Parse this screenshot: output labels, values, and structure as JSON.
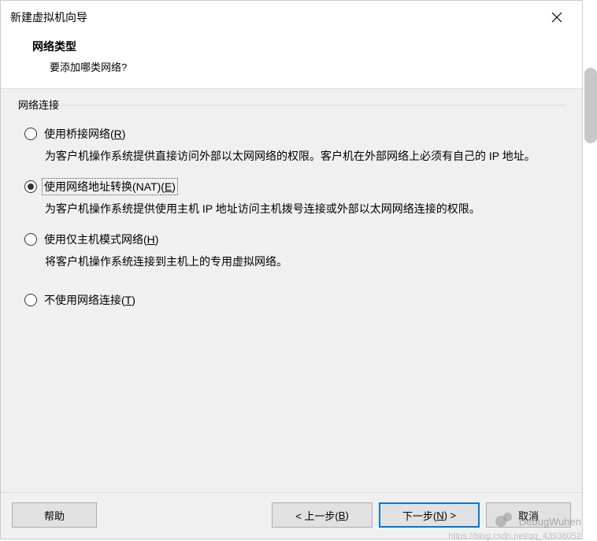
{
  "titlebar": {
    "title": "新建虚拟机向导"
  },
  "header": {
    "title": "网络类型",
    "subtitle": "要添加哪类网络?"
  },
  "group": {
    "label": "网络连接"
  },
  "options": {
    "bridged": {
      "label_pre": "使用桥接网络(",
      "mnemonic": "R",
      "label_post": ")",
      "desc": "为客户机操作系统提供直接访问外部以太网网络的权限。客户机在外部网络上必须有自己的 IP 地址。"
    },
    "nat": {
      "label_pre": "使用网络地址转换(NAT)(",
      "mnemonic": "E",
      "label_post": ")",
      "desc": "为客户机操作系统提供使用主机 IP 地址访问主机拨号连接或外部以太网网络连接的权限。"
    },
    "hostonly": {
      "label_pre": "使用仅主机模式网络(",
      "mnemonic": "H",
      "label_post": ")",
      "desc": "将客户机操作系统连接到主机上的专用虚拟网络。"
    },
    "none": {
      "label_pre": "不使用网络连接(",
      "mnemonic": "T",
      "label_post": ")"
    }
  },
  "footer": {
    "help": "帮助",
    "back_pre": "< 上一步(",
    "back_m": "B",
    "back_post": ")",
    "next_pre": "下一步(",
    "next_m": "N",
    "next_post": ") >",
    "cancel": "取消"
  },
  "watermark": {
    "text": "DebugWuhen",
    "sub": "https://blog.csdn.net/qq_43938052"
  }
}
